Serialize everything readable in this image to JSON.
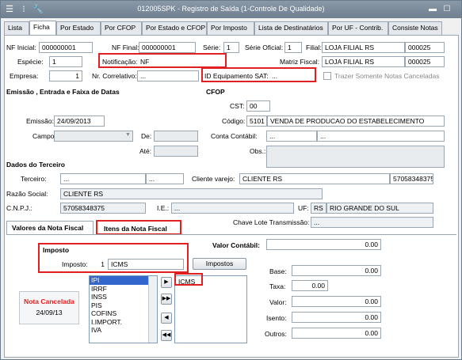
{
  "window": {
    "title": "012005SPK - Registro de Saída (1-Controle De Qualidade)"
  },
  "tabs": [
    "Lista",
    "Ficha",
    "Por Estado",
    "Por CFOP",
    "Por Estado e CFOP",
    "Por Imposto",
    "Lista de Destinatários",
    "Por UF - Contrib.",
    "Consiste Notas"
  ],
  "header": {
    "nf_inicial_label": "NF Inicial:",
    "nf_inicial": "000000001",
    "nf_final_label": "NF Final:",
    "nf_final": "000000001",
    "serie_label": "Série:",
    "serie": "1",
    "serie_oficial_label": "Série Oficial:",
    "serie_oficial": "1",
    "filial_label": "Filial:",
    "filial": "LOJA FILIAL RS",
    "filial_code": "000025",
    "especie_label": "Espécie:",
    "especie": "1",
    "notificacao_label": "Notificação:",
    "notificacao": "NF",
    "matriz_fiscal_label": "Matriz Fiscal:",
    "matriz_fiscal": "LOJA FILIAL RS",
    "matriz_code": "000025",
    "empresa_label": "Empresa:",
    "empresa": "1",
    "nr_correlativo_label": "Nr. Correlativo:",
    "nr_correlativo": "...",
    "id_equip_label": "ID Equipamento SAT:",
    "id_equip": "...",
    "trazer_label": "Trazer Somente Notas Canceladas"
  },
  "emissao": {
    "section_title": "Emissão , Entrada e Faixa de Datas",
    "emissao_label": "Emissão:",
    "emissao": "24/09/2013",
    "campo_label": "Campo:",
    "de_label": "De:",
    "ate_label": "Até:"
  },
  "cfop": {
    "section_title": "CFOP",
    "cst_label": "CST:",
    "cst": "00",
    "codigo_label": "Código:",
    "codigo": "5101",
    "codigo_desc": "VENDA DE PRODUCAO DO ESTABELECIMENTO",
    "conta_label": "Conta Contábil:",
    "conta": "...",
    "conta2": "...",
    "obs_label": "Obs.:"
  },
  "terceiro": {
    "section_title": "Dados do Terceiro",
    "terceiro_label": "Terceiro:",
    "terceiro": "...",
    "terceiro2": "...",
    "cliente_varejo_label": "Cliente varejo:",
    "cliente_varejo": "CLIENTE RS",
    "cliente_code": "57058348375",
    "razao_label": "Razão Social:",
    "razao": "CLIENTE RS",
    "cnpj_label": "C.N.P.J.:",
    "cnpj": "57058348375",
    "ie_label": "I.E.:",
    "ie": "...",
    "uf_label": "UF:",
    "uf": "RS",
    "uf_desc": "RIO GRANDE DO SUL",
    "chave_label": "Chave Lote Transmissão:",
    "chave": "..."
  },
  "subtabs": [
    "Valores da Nota Fiscal",
    "Itens da Nota Fiscal"
  ],
  "valores": {
    "imposto_title": "Imposto",
    "imposto_label": "Imposto:",
    "imposto_num": "1",
    "imposto_name": "ICMS",
    "impostos_button": "Impostos",
    "valor_contabil_label": "Valor Contábil:",
    "valor_contabil": "0.00",
    "list_left": [
      "IPI",
      "IRRF",
      "INSS",
      "PIS",
      "COFINS",
      "I.IMPORT.",
      "IVA"
    ],
    "list_right": [
      "ICMS"
    ],
    "base_label": "Base:",
    "base": "0.00",
    "taxa_label": "Taxa:",
    "taxa": "0.00",
    "valor_label": "Valor:",
    "valor": "0.00",
    "isento_label": "Isento:",
    "isento": "0.00",
    "outros_label": "Outros:",
    "outros": "0.00",
    "nota_cancelada": "Nota Cancelada",
    "nota_cancelada_date": "24/09/13"
  }
}
